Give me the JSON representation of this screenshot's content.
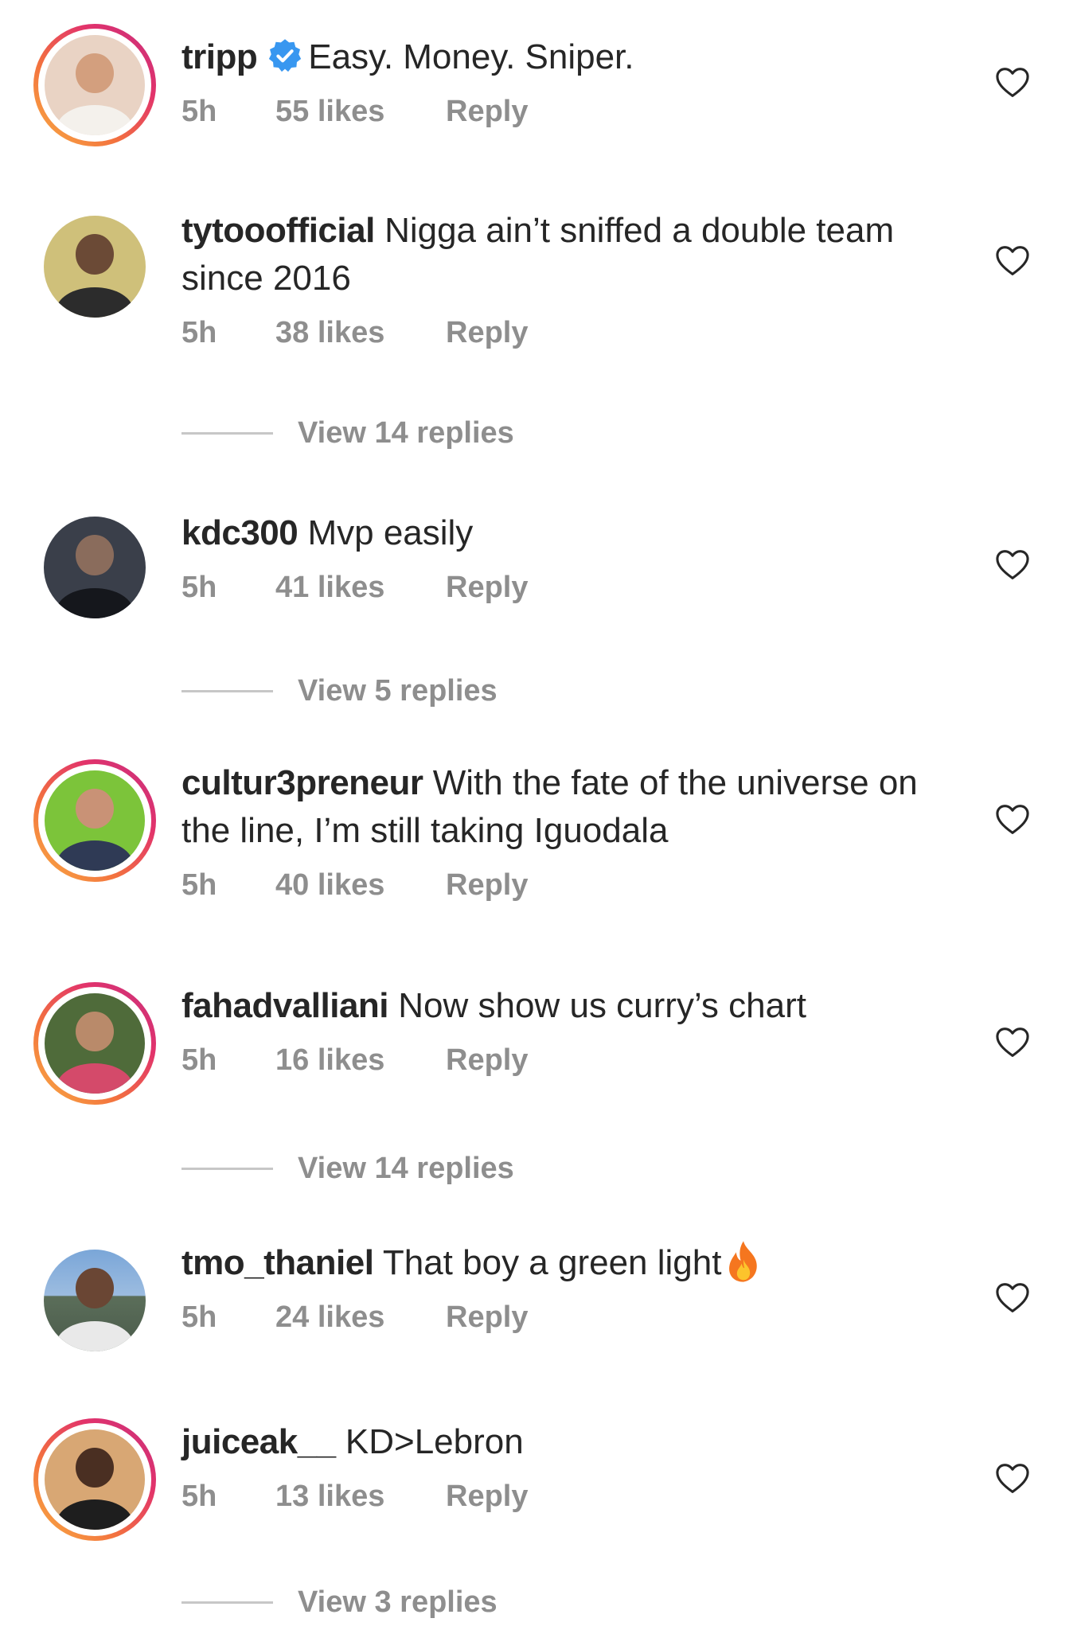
{
  "comments": [
    {
      "username": "tripp",
      "verified": true,
      "text": "Easy. Money. Sniper.",
      "time": "5h",
      "likes": "55 likes",
      "reply": "Reply",
      "avatar_style": "story-ring"
    },
    {
      "username": "tytooofficial",
      "verified": false,
      "text": "Nigga ain’t sniffed a double team since 2016",
      "time": "5h",
      "likes": "38 likes",
      "reply": "Reply",
      "view_replies": "View 14 replies",
      "avatar_style": "plain"
    },
    {
      "username": "kdc300",
      "verified": false,
      "text": "Mvp easily",
      "time": "5h",
      "likes": "41 likes",
      "reply": "Reply",
      "view_replies": "View 5 replies",
      "avatar_style": "plain"
    },
    {
      "username": "cultur3preneur",
      "verified": false,
      "text": "With the fate of the universe on the line, I’m still taking Iguodala",
      "time": "5h",
      "likes": "40 likes",
      "reply": "Reply",
      "avatar_style": "story-ring"
    },
    {
      "username": "fahadvalliani",
      "verified": false,
      "text": "Now show us curry’s chart",
      "time": "5h",
      "likes": "16 likes",
      "reply": "Reply",
      "view_replies": "View 14 replies",
      "avatar_style": "story-ring"
    },
    {
      "username": "tmo_thaniel",
      "verified": false,
      "text": "That boy a green light",
      "emoji": "fire-icon",
      "time": "5h",
      "likes": "24 likes",
      "reply": "Reply",
      "avatar_style": "plain"
    },
    {
      "username": "juiceak__",
      "verified": false,
      "text": "KD>Lebron",
      "time": "5h",
      "likes": "13 likes",
      "reply": "Reply",
      "view_replies": "View 3 replies",
      "avatar_style": "story-ring"
    }
  ],
  "icons": {
    "like": "heart-outline-icon",
    "verified": "verified-badge-icon"
  },
  "colors": {
    "text": "#262626",
    "meta": "#8e8e8e",
    "verified": "#3897f0",
    "ring_start": "#f9b044",
    "ring_end": "#c6307f"
  }
}
